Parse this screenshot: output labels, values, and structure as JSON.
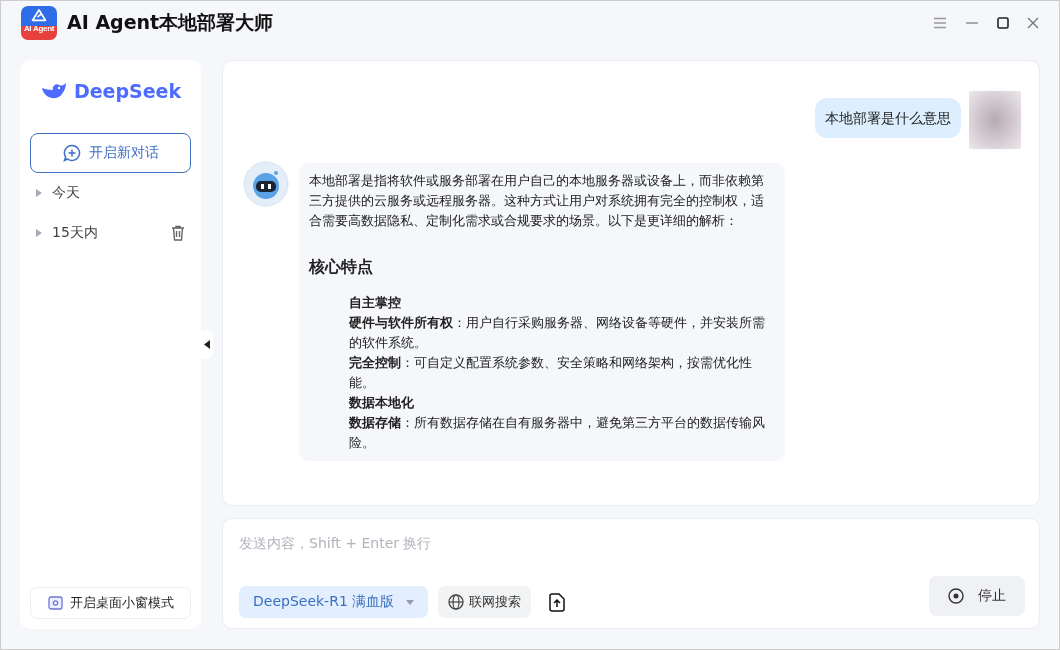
{
  "window": {
    "title": "AI Agent本地部署大师",
    "logo_text": "AI Agent"
  },
  "sidebar": {
    "brand": "DeepSeek",
    "new_chat": "开启新对话",
    "groups": [
      {
        "label": "今天",
        "expanded": false,
        "hovered": false
      },
      {
        "label": "15天内",
        "expanded": false,
        "hovered": true
      }
    ],
    "mini_mode": "开启桌面小窗模式"
  },
  "messages": [
    {
      "kind": "user",
      "text": "本地部署是什么意思"
    },
    {
      "kind": "assistant",
      "blocks": [
        {
          "kind": "paragraph",
          "text": "本地部署是指将软件或服务部署在用户自己的本地服务器或设备上，而非依赖第三方提供的云服务或远程服务器。这种方式让用户对系统拥有完全的控制权，适合需要高数据隐私、定制化需求或合规要求的场景。以下是更详细的解析："
        },
        {
          "kind": "heading",
          "text": "核心特点"
        },
        {
          "kind": "subheading",
          "text": "自主掌控"
        },
        {
          "kind": "item",
          "text": "**硬件与软件所有权**：用户自行采购服务器、网络设备等硬件，并安装所需的软件系统。"
        },
        {
          "kind": "item",
          "text": "**完全控制**：可自定义配置系统参数、安全策略和网络架构，按需优化性能。"
        },
        {
          "kind": "subheading",
          "text": "数据本地化"
        },
        {
          "kind": "item",
          "text": "**数据存储**：所有数据存储在自有服务器中，避免第三方平台的数据传输风险。"
        }
      ]
    }
  ],
  "composer": {
    "placeholder": "发送内容，Shift + Enter 换行",
    "model": "DeepSeek-R1 满血版",
    "web_search": "联网搜索",
    "stop": "停止"
  }
}
